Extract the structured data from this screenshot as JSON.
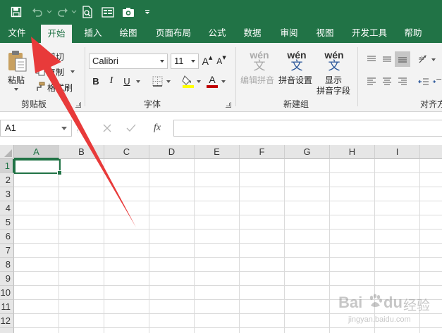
{
  "quick_access": {
    "save_icon": "save-icon",
    "undo_icon": "undo-icon",
    "redo_icon": "redo-icon",
    "print_preview_icon": "print-preview-icon",
    "form_icon": "form-icon",
    "camera_icon": "camera-icon",
    "customize_icon": "customize-dropdown-icon"
  },
  "tabs": [
    {
      "label": "文件"
    },
    {
      "label": "开始",
      "active": true
    },
    {
      "label": "插入"
    },
    {
      "label": "绘图"
    },
    {
      "label": "页面布局"
    },
    {
      "label": "公式"
    },
    {
      "label": "数据"
    },
    {
      "label": "审阅"
    },
    {
      "label": "视图"
    },
    {
      "label": "开发工具"
    },
    {
      "label": "帮助"
    }
  ],
  "ribbon": {
    "clipboard": {
      "paste_label": "粘贴",
      "cut_label": "剪切",
      "copy_label": "复制",
      "format_painter_label": "格式刷",
      "group_label": "剪贴板"
    },
    "font": {
      "font_name": "Calibri",
      "font_size": "11",
      "increase_size_label": "A",
      "decrease_size_label": "A",
      "bold_label": "B",
      "italic_label": "I",
      "underline_label": "U",
      "fill_color": "#ffff00",
      "font_color": "#c00000",
      "font_color_label": "A",
      "group_label": "字体"
    },
    "new_group": {
      "edit_pinyin_py": "wén",
      "edit_pinyin_hz": "文",
      "edit_pinyin_label": "编辑拼音",
      "pinyin_settings_py": "wén",
      "pinyin_settings_hz": "文",
      "pinyin_settings_label": "拼音设置",
      "show_pinyin_py": "wén",
      "show_pinyin_hz": "文",
      "show_pinyin_label_line1": "显示",
      "show_pinyin_label_line2": "拼音字段",
      "group_label": "新建组"
    },
    "alignment": {
      "group_label": "对齐方"
    }
  },
  "formula_bar": {
    "name_box": "A1",
    "cancel_icon": "cancel-icon",
    "enter_icon": "check-icon",
    "fx_label": "fx",
    "formula_value": ""
  },
  "sheet": {
    "columns": [
      "A",
      "B",
      "C",
      "D",
      "E",
      "F",
      "G",
      "H",
      "I"
    ],
    "rows": [
      "1",
      "2",
      "3",
      "4",
      "5",
      "6",
      "7",
      "8",
      "9",
      "10",
      "11",
      "12"
    ],
    "active_cell": "A1"
  },
  "annotation": {
    "arrow_color": "#e83a3a",
    "arrow_icon": "red-arrow-pointing-to-file-tab"
  },
  "watermark": {
    "brand": "Bai",
    "du": "du",
    "paw_icon": "baidu-paw-icon",
    "jingyan": "经验",
    "url": "jingyan.baidu.com"
  },
  "colors": {
    "accent": "#217346",
    "ribbon_bg": "#f3f3f3"
  }
}
